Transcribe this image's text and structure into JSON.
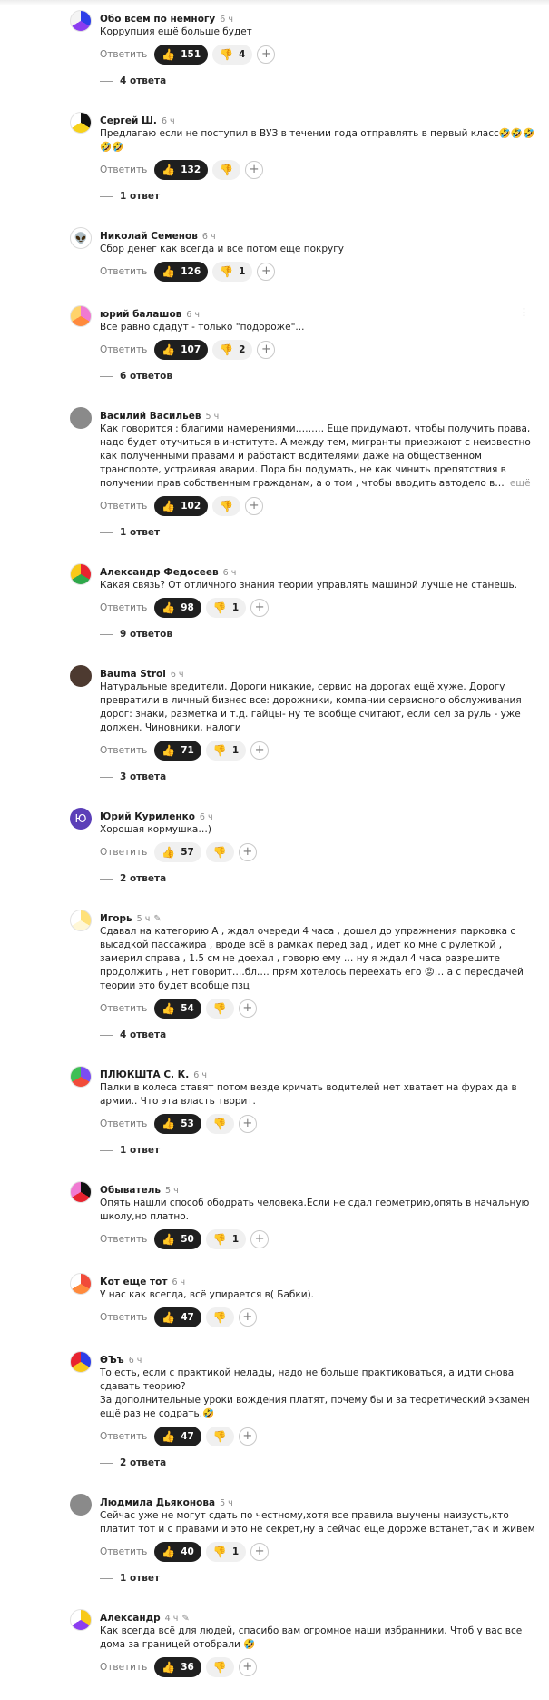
{
  "reply_label": "Ответить",
  "more_label": "ещё",
  "comments": [
    {
      "author": "Обо всем по немногу",
      "time": "6 ч",
      "avatar": {
        "type": "pie",
        "colors": [
          "#2d3ee8",
          "#8b3df0",
          "#f4f4f4"
        ]
      },
      "text": "Коррупция ещё больше будет",
      "likes": "151",
      "dislikes": "4",
      "replies": "4 ответа"
    },
    {
      "author": "Сергей Ш.",
      "time": "6 ч",
      "avatar": {
        "type": "pie",
        "colors": [
          "#111111",
          "#f7d21a",
          "#ffffff"
        ]
      },
      "text": "Предлагаю если не поступил в ВУЗ в течении года отправлять в первый класс🤣🤣🤣🤣🤣",
      "likes": "132",
      "dislikes": "",
      "replies": "1 ответ"
    },
    {
      "author": "Николай Семенов",
      "time": "6 ч",
      "avatar": {
        "type": "alien",
        "glyph": "👽"
      },
      "text": "Сбор денег как всегда и все потом еще покругу",
      "likes": "126",
      "dislikes": "1",
      "replies": ""
    },
    {
      "author": "юрий балашов",
      "time": "6 ч",
      "avatar": {
        "type": "pie",
        "colors": [
          "#f07ad2",
          "#ff8a3d",
          "#ffd36b"
        ]
      },
      "text": "Всё равно сдадут - только \"подороже\"...",
      "likes": "107",
      "dislikes": "2",
      "replies": "6 ответов",
      "has_more_menu": true
    },
    {
      "author": "Василий Васильев",
      "time": "5 ч",
      "avatar": {
        "type": "photo"
      },
      "text": "Как говорится : благими намерениями……… Еще придумают, чтобы получить права, надо будет отучиться в институте. А между тем, мигранты приезжают с неизвестно как полученными правами и работают водителями даже на общественном транспорте, устраивая аварии. Пора бы подумать, не как чинить препятствия в получении прав собственным гражданам, а о том , чтобы вводить автодело в…",
      "truncated": true,
      "likes": "102",
      "dislikes": "",
      "replies": "1 ответ"
    },
    {
      "author": "Александр Федосеев",
      "time": "6 ч",
      "avatar": {
        "type": "pie",
        "colors": [
          "#e8232f",
          "#2ea84a",
          "#f8c91a"
        ]
      },
      "text": "Какая связь? От отличного знания теории управлять машиной лучше не станешь.",
      "likes": "98",
      "dislikes": "1",
      "replies": "9 ответов"
    },
    {
      "author": "Bauma Stroi",
      "time": "6 ч",
      "avatar": {
        "type": "photo-dark"
      },
      "text": "Натуральные вредители. Дороги никакие, сервис на дорогах ещё хуже. Дорогу превратили в личный бизнес все: дорожники, компании сервисного обслуживания дорог: знаки, разметка и т.д. гайцы- ну те вообще считают, если сел за руль - уже должен. Чиновники, налоги",
      "likes": "71",
      "dislikes": "1",
      "replies": "3 ответа"
    },
    {
      "author": "Юрий Куриленко",
      "time": "6 ч",
      "avatar": {
        "type": "letter",
        "glyph": "Ю"
      },
      "text": "Хорошая кормушка…)",
      "likes": "57",
      "likes_light": true,
      "dislikes": "",
      "replies": "2 ответа"
    },
    {
      "author": "Игорь",
      "time": "5 ч",
      "edited": true,
      "avatar": {
        "type": "pie",
        "colors": [
          "#ffe17a",
          "#fff7d6",
          "#ffffff"
        ]
      },
      "text": "Сдавал на категорию А , ждал очереди 4 часа , дошел до упражнения парковка с высадкой пассажира , вроде всё в рамках перед зад , идет ко мне с рулеткой , замерил справа , 1.5 см не доехал , говорю ему … ну я ждал 4 часа разрешите продолжить , нет говорит….бл…. прям хотелось переехать его 😡… а с пересдачей теории это будет вообще пзц",
      "likes": "54",
      "dislikes": "",
      "replies": "4 ответа"
    },
    {
      "author": "ПЛЮКШТА С. К.",
      "time": "6 ч",
      "avatar": {
        "type": "pie",
        "colors": [
          "#7b4df2",
          "#f14b3a",
          "#3fbf55"
        ]
      },
      "text": "Палки в колеса ставят потом везде кричать водителей нет хватает на фурах да в армии.. Что эта власть творит.",
      "likes": "53",
      "dislikes": "",
      "replies": "1 ответ"
    },
    {
      "author": "Обыватель",
      "time": "5 ч",
      "avatar": {
        "type": "pie",
        "colors": [
          "#111111",
          "#e8232f",
          "#f07ad2"
        ]
      },
      "text": "Опять нашли способ ободрать человека.Если не сдал геометрию,опять в начальную школу,но платно.",
      "likes": "50",
      "dislikes": "1",
      "replies": ""
    },
    {
      "author": "Кот еще тот",
      "time": "6 ч",
      "avatar": {
        "type": "pie",
        "colors": [
          "#f14b3a",
          "#ff8a3d",
          "#ffffff"
        ]
      },
      "text": "У нас как всегда, всё упирается в( Бабки).",
      "likes": "47",
      "dislikes": "",
      "replies": ""
    },
    {
      "author": "ӨЪъ",
      "time": "6 ч",
      "avatar": {
        "type": "pie",
        "colors": [
          "#2d3ee8",
          "#f8c91a",
          "#e8232f"
        ]
      },
      "text": "То есть, если с практикой нелады, надо не больше практиковаться, а идти снова сдавать теорию?\nЗа дополнительные уроки вождения платят, почему бы и за теоретический экзамен ещё раз не содрать.🤣",
      "likes": "47",
      "dislikes": "",
      "replies": "2 ответа"
    },
    {
      "author": "Людмила Дьяконова",
      "time": "5 ч",
      "avatar": {
        "type": "photo"
      },
      "text": "Сейчас уже не могут сдать по честному,хотя все правила выучены наизусть,кто платит тот и с правами и это не секрет,ну а сейчас еще дороже встанет,так и живем",
      "likes": "40",
      "dislikes": "1",
      "replies": "1 ответ"
    },
    {
      "author": "Александр",
      "time": "4 ч",
      "edited": true,
      "avatar": {
        "type": "pie",
        "colors": [
          "#f8c91a",
          "#8b3df0",
          "#ffffff"
        ]
      },
      "text": "Как всегда всё для людей, спасибо вам огромное наши избранники. Чтоб у вас все дома за границей отобрали 🤣",
      "likes": "36",
      "dislikes": "",
      "replies": ""
    }
  ],
  "colors": {
    "like_dark": "#1f1f1f",
    "like_light": "#f0f0f0",
    "thumb": "#f3a42b",
    "muted": "#8a8a8a"
  }
}
